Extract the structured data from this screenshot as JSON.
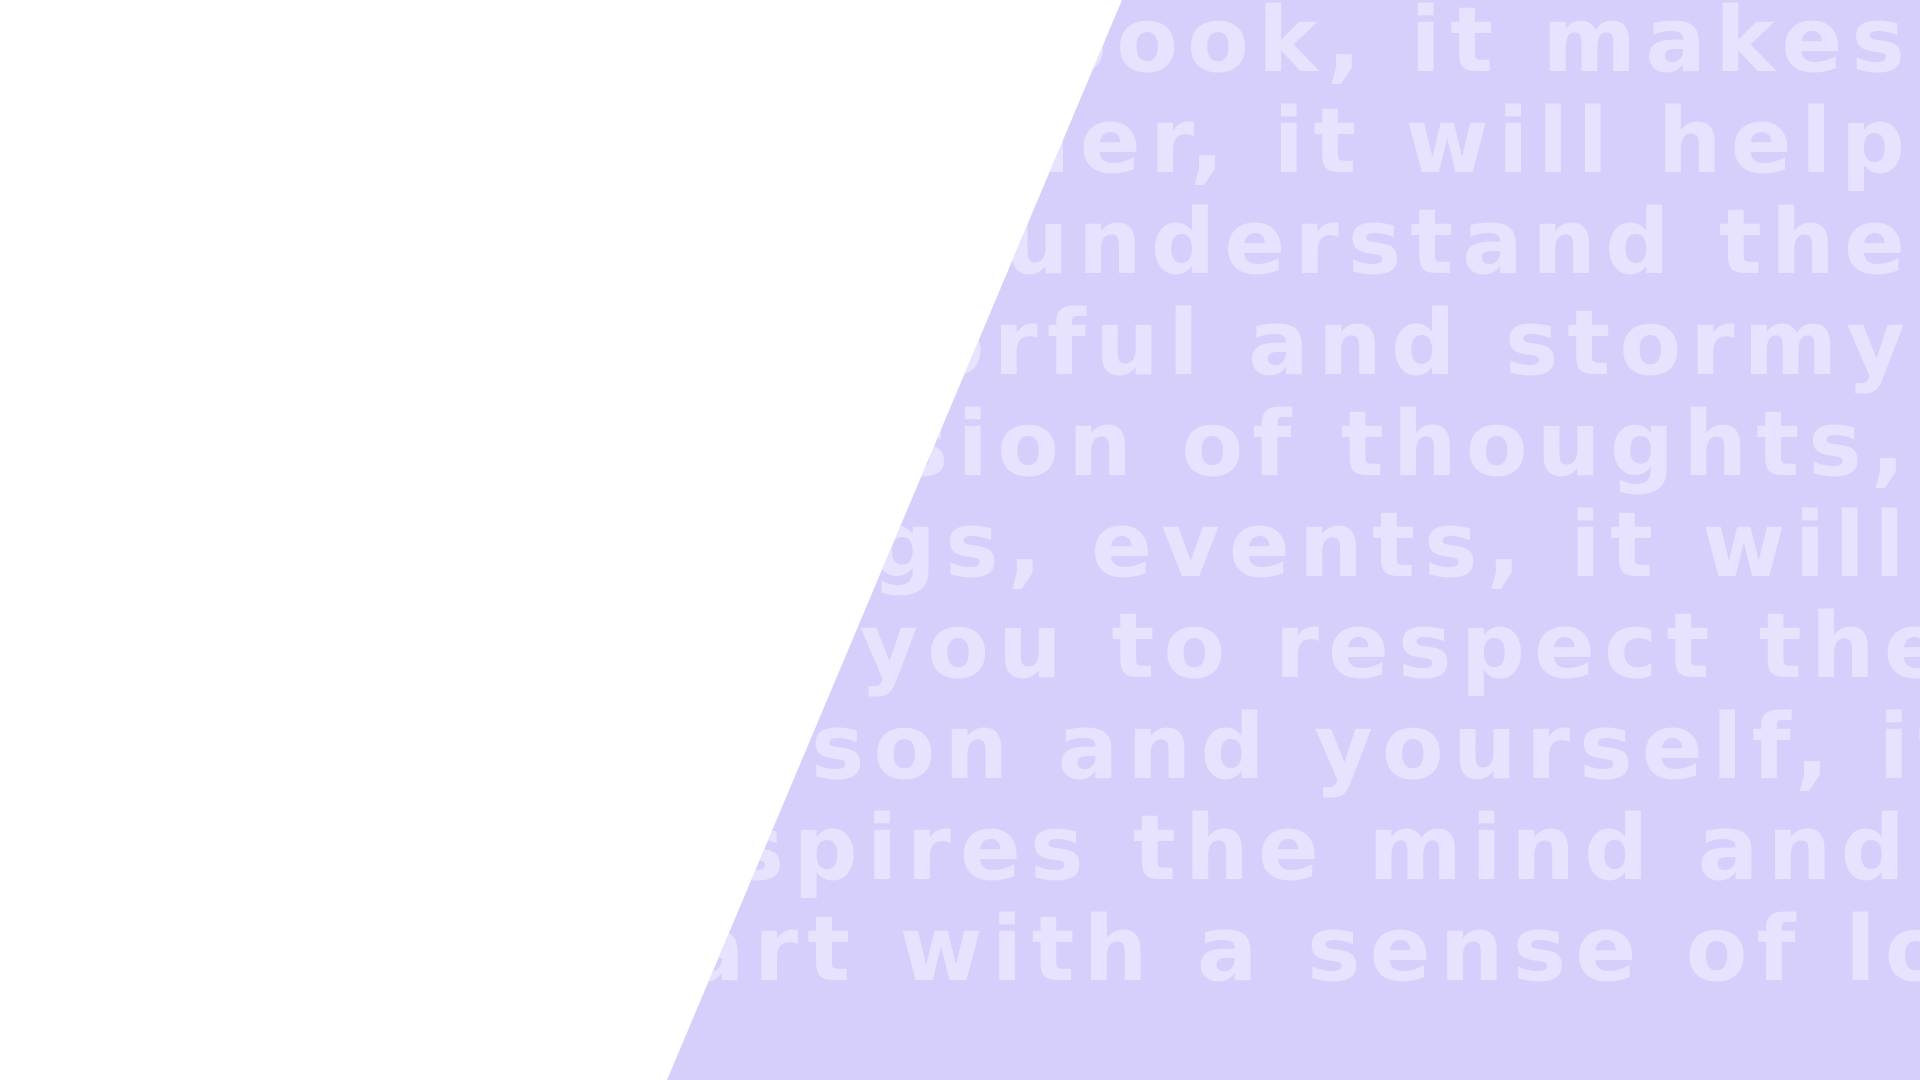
{
  "colors": {
    "background": "#ffffff",
    "panel": "#d6cefb",
    "text": "#e7e2fd"
  },
  "quote": {
    "lines": [
      "e book, it makes",
      "easier, it will help",
      "to understand the",
      "colorful and stormy",
      "nfusion of thoughts,",
      "elings, events, it will",
      "ach you to respect the",
      "person and yourself, it",
      "inspires the mind and",
      "eart with a sense of love"
    ]
  }
}
